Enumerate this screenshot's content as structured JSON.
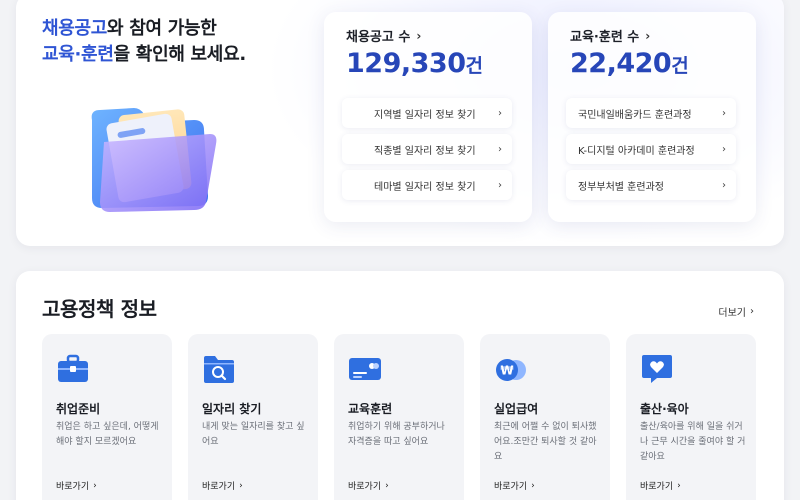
{
  "hero": {
    "title_part1_blue": "채용공고",
    "title_part1_rest": "와 참여 가능한",
    "title_part2_blue": "교육·훈련",
    "title_part2_rest": "을 확인해 보세요."
  },
  "jobs": {
    "label": "채용공고 수",
    "count": "129,330",
    "unit": "건",
    "links": [
      "지역별 일자리 정보 찾기",
      "직종별 일자리 정보 찾기",
      "테마별 일자리 정보 찾기"
    ]
  },
  "edu": {
    "label": "교육·훈련 수",
    "count": "22,420",
    "unit": "건",
    "links": [
      "국민내일배움카드 훈련과정",
      "K-디지털 아카데미 훈련과정",
      "정부부처별 훈련과정"
    ]
  },
  "policy": {
    "title": "고용정책 정보",
    "more_label": "더보기",
    "tiles": [
      {
        "name": "취업준비",
        "desc": "취업은 하고 싶은데, 어떻게 해야 할지 모르겠어요",
        "go": "바로가기",
        "icon": "briefcase-icon"
      },
      {
        "name": "일자리 찾기",
        "desc": "내게 맞는 일자리를 찾고 싶어요",
        "go": "바로가기",
        "icon": "folder-search-icon"
      },
      {
        "name": "교육훈련",
        "desc": "취업하기 위해 공부하거나 자격증을 따고 싶어요",
        "go": "바로가기",
        "icon": "card-icon"
      },
      {
        "name": "실업급여",
        "desc": "최근에 어쩔 수 없이 퇴사했어요.조만간 퇴사할 것 같아요",
        "go": "바로가기",
        "icon": "won-coin-icon"
      },
      {
        "name": "출산·육아",
        "desc": "출산/육아를 위해 일을 쉬거나 근무 시간을 줄여야 할 거 같아요",
        "go": "바로가기",
        "icon": "heart-chat-icon"
      }
    ]
  },
  "colors": {
    "accent": "#2f55d4",
    "count": "#2746b8",
    "icon": "#2f6fe0"
  },
  "chevron": "›"
}
